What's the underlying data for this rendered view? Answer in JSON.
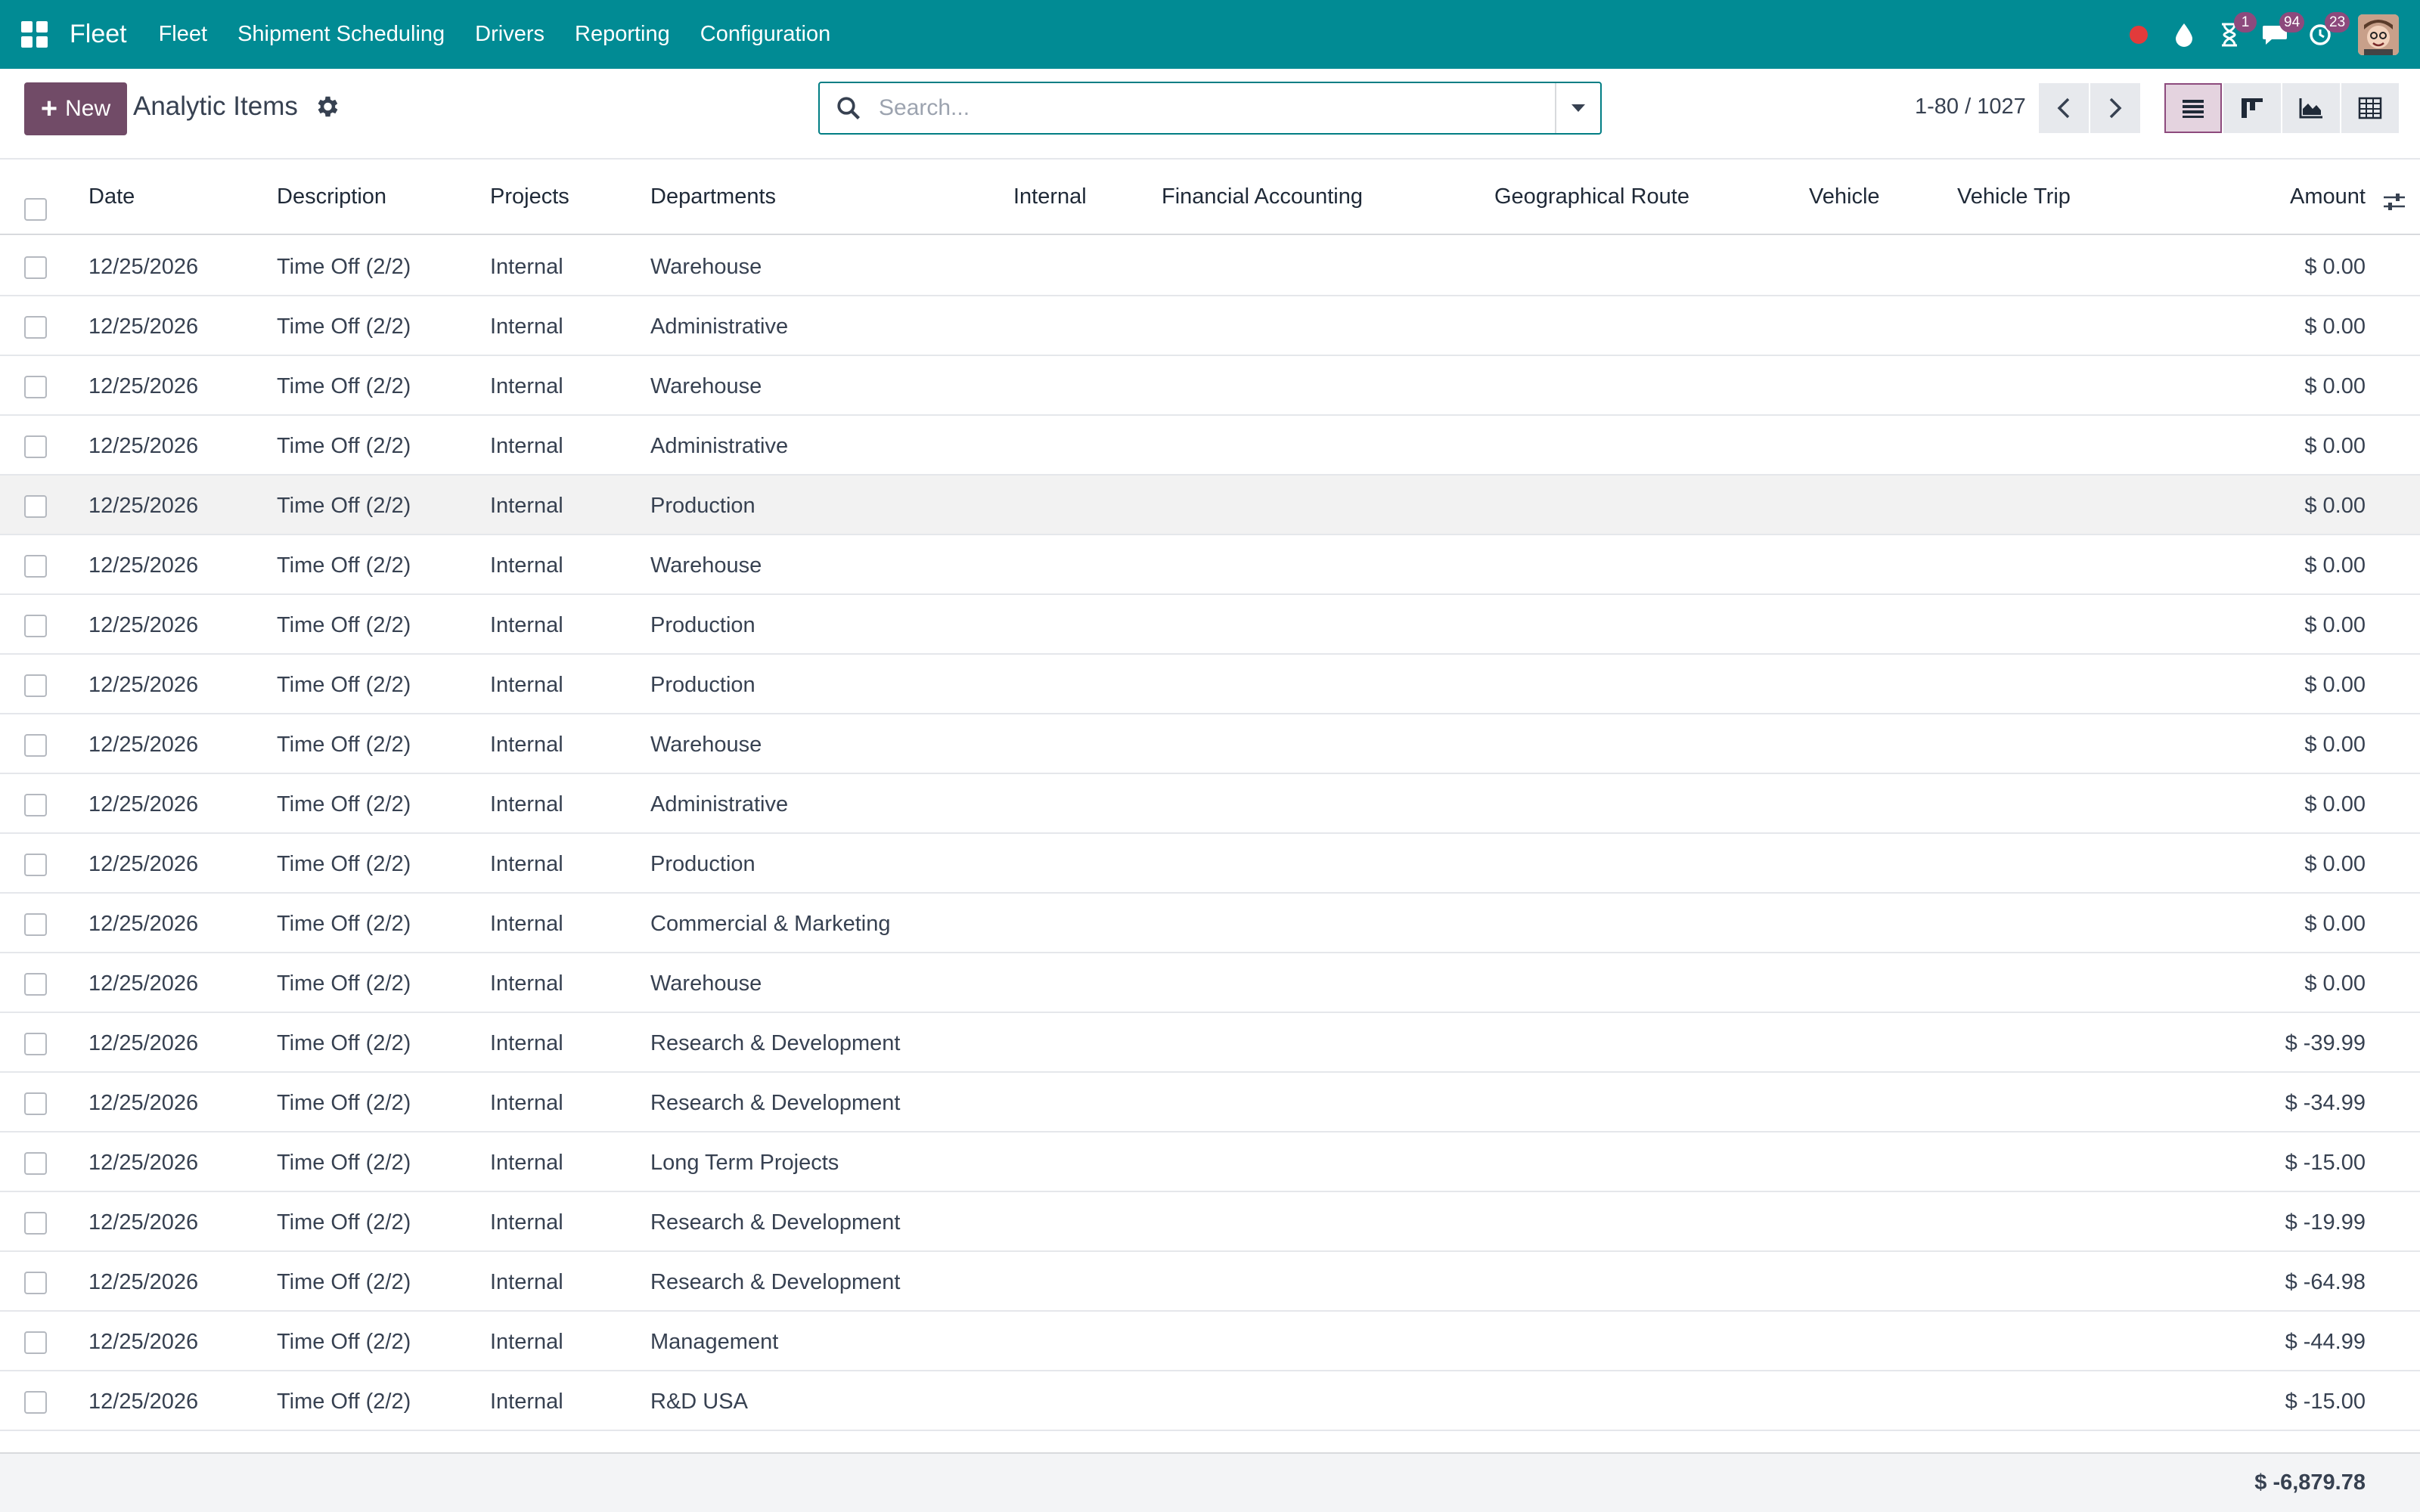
{
  "navbar": {
    "brand": "Fleet",
    "menu": [
      "Fleet",
      "Shipment Scheduling",
      "Drivers",
      "Reporting",
      "Configuration"
    ],
    "badges": {
      "activities": "1",
      "messages": "94",
      "updates": "23"
    },
    "colors": {
      "bar": "#018b94",
      "badge": "#8d4a7d",
      "status_dot": "#e23b3b"
    }
  },
  "control": {
    "new_label": "New",
    "title": "Analytic Items",
    "search_placeholder": "Search...",
    "pager": "1-80 / 1027"
  },
  "table": {
    "headers": [
      "Date",
      "Description",
      "Projects",
      "Departments",
      "Internal",
      "Financial Accounting",
      "Geographical Route",
      "Vehicle",
      "Vehicle Trip",
      "Amount"
    ],
    "rows": [
      {
        "date": "12/25/2026",
        "desc": "Time Off (2/2)",
        "project": "Internal",
        "dept": "Warehouse",
        "amount": "$ 0.00"
      },
      {
        "date": "12/25/2026",
        "desc": "Time Off (2/2)",
        "project": "Internal",
        "dept": "Administrative",
        "amount": "$ 0.00"
      },
      {
        "date": "12/25/2026",
        "desc": "Time Off (2/2)",
        "project": "Internal",
        "dept": "Warehouse",
        "amount": "$ 0.00"
      },
      {
        "date": "12/25/2026",
        "desc": "Time Off (2/2)",
        "project": "Internal",
        "dept": "Administrative",
        "amount": "$ 0.00"
      },
      {
        "date": "12/25/2026",
        "desc": "Time Off (2/2)",
        "project": "Internal",
        "dept": "Production",
        "amount": "$ 0.00"
      },
      {
        "date": "12/25/2026",
        "desc": "Time Off (2/2)",
        "project": "Internal",
        "dept": "Warehouse",
        "amount": "$ 0.00"
      },
      {
        "date": "12/25/2026",
        "desc": "Time Off (2/2)",
        "project": "Internal",
        "dept": "Production",
        "amount": "$ 0.00"
      },
      {
        "date": "12/25/2026",
        "desc": "Time Off (2/2)",
        "project": "Internal",
        "dept": "Production",
        "amount": "$ 0.00"
      },
      {
        "date": "12/25/2026",
        "desc": "Time Off (2/2)",
        "project": "Internal",
        "dept": "Warehouse",
        "amount": "$ 0.00"
      },
      {
        "date": "12/25/2026",
        "desc": "Time Off (2/2)",
        "project": "Internal",
        "dept": "Administrative",
        "amount": "$ 0.00"
      },
      {
        "date": "12/25/2026",
        "desc": "Time Off (2/2)",
        "project": "Internal",
        "dept": "Production",
        "amount": "$ 0.00"
      },
      {
        "date": "12/25/2026",
        "desc": "Time Off (2/2)",
        "project": "Internal",
        "dept": "Commercial & Marketing",
        "amount": "$ 0.00"
      },
      {
        "date": "12/25/2026",
        "desc": "Time Off (2/2)",
        "project": "Internal",
        "dept": "Warehouse",
        "amount": "$ 0.00"
      },
      {
        "date": "12/25/2026",
        "desc": "Time Off (2/2)",
        "project": "Internal",
        "dept": "Research & Development",
        "amount": "$ -39.99"
      },
      {
        "date": "12/25/2026",
        "desc": "Time Off (2/2)",
        "project": "Internal",
        "dept": "Research & Development",
        "amount": "$ -34.99"
      },
      {
        "date": "12/25/2026",
        "desc": "Time Off (2/2)",
        "project": "Internal",
        "dept": "Long Term Projects",
        "amount": "$ -15.00"
      },
      {
        "date": "12/25/2026",
        "desc": "Time Off (2/2)",
        "project": "Internal",
        "dept": "Research & Development",
        "amount": "$ -19.99"
      },
      {
        "date": "12/25/2026",
        "desc": "Time Off (2/2)",
        "project": "Internal",
        "dept": "Research & Development",
        "amount": "$ -64.98"
      },
      {
        "date": "12/25/2026",
        "desc": "Time Off (2/2)",
        "project": "Internal",
        "dept": "Management",
        "amount": "$ -44.99"
      },
      {
        "date": "12/25/2026",
        "desc": "Time Off (2/2)",
        "project": "Internal",
        "dept": "R&D USA",
        "amount": "$ -15.00"
      }
    ],
    "hover_row": 4,
    "total": "$ -6,879.78"
  }
}
